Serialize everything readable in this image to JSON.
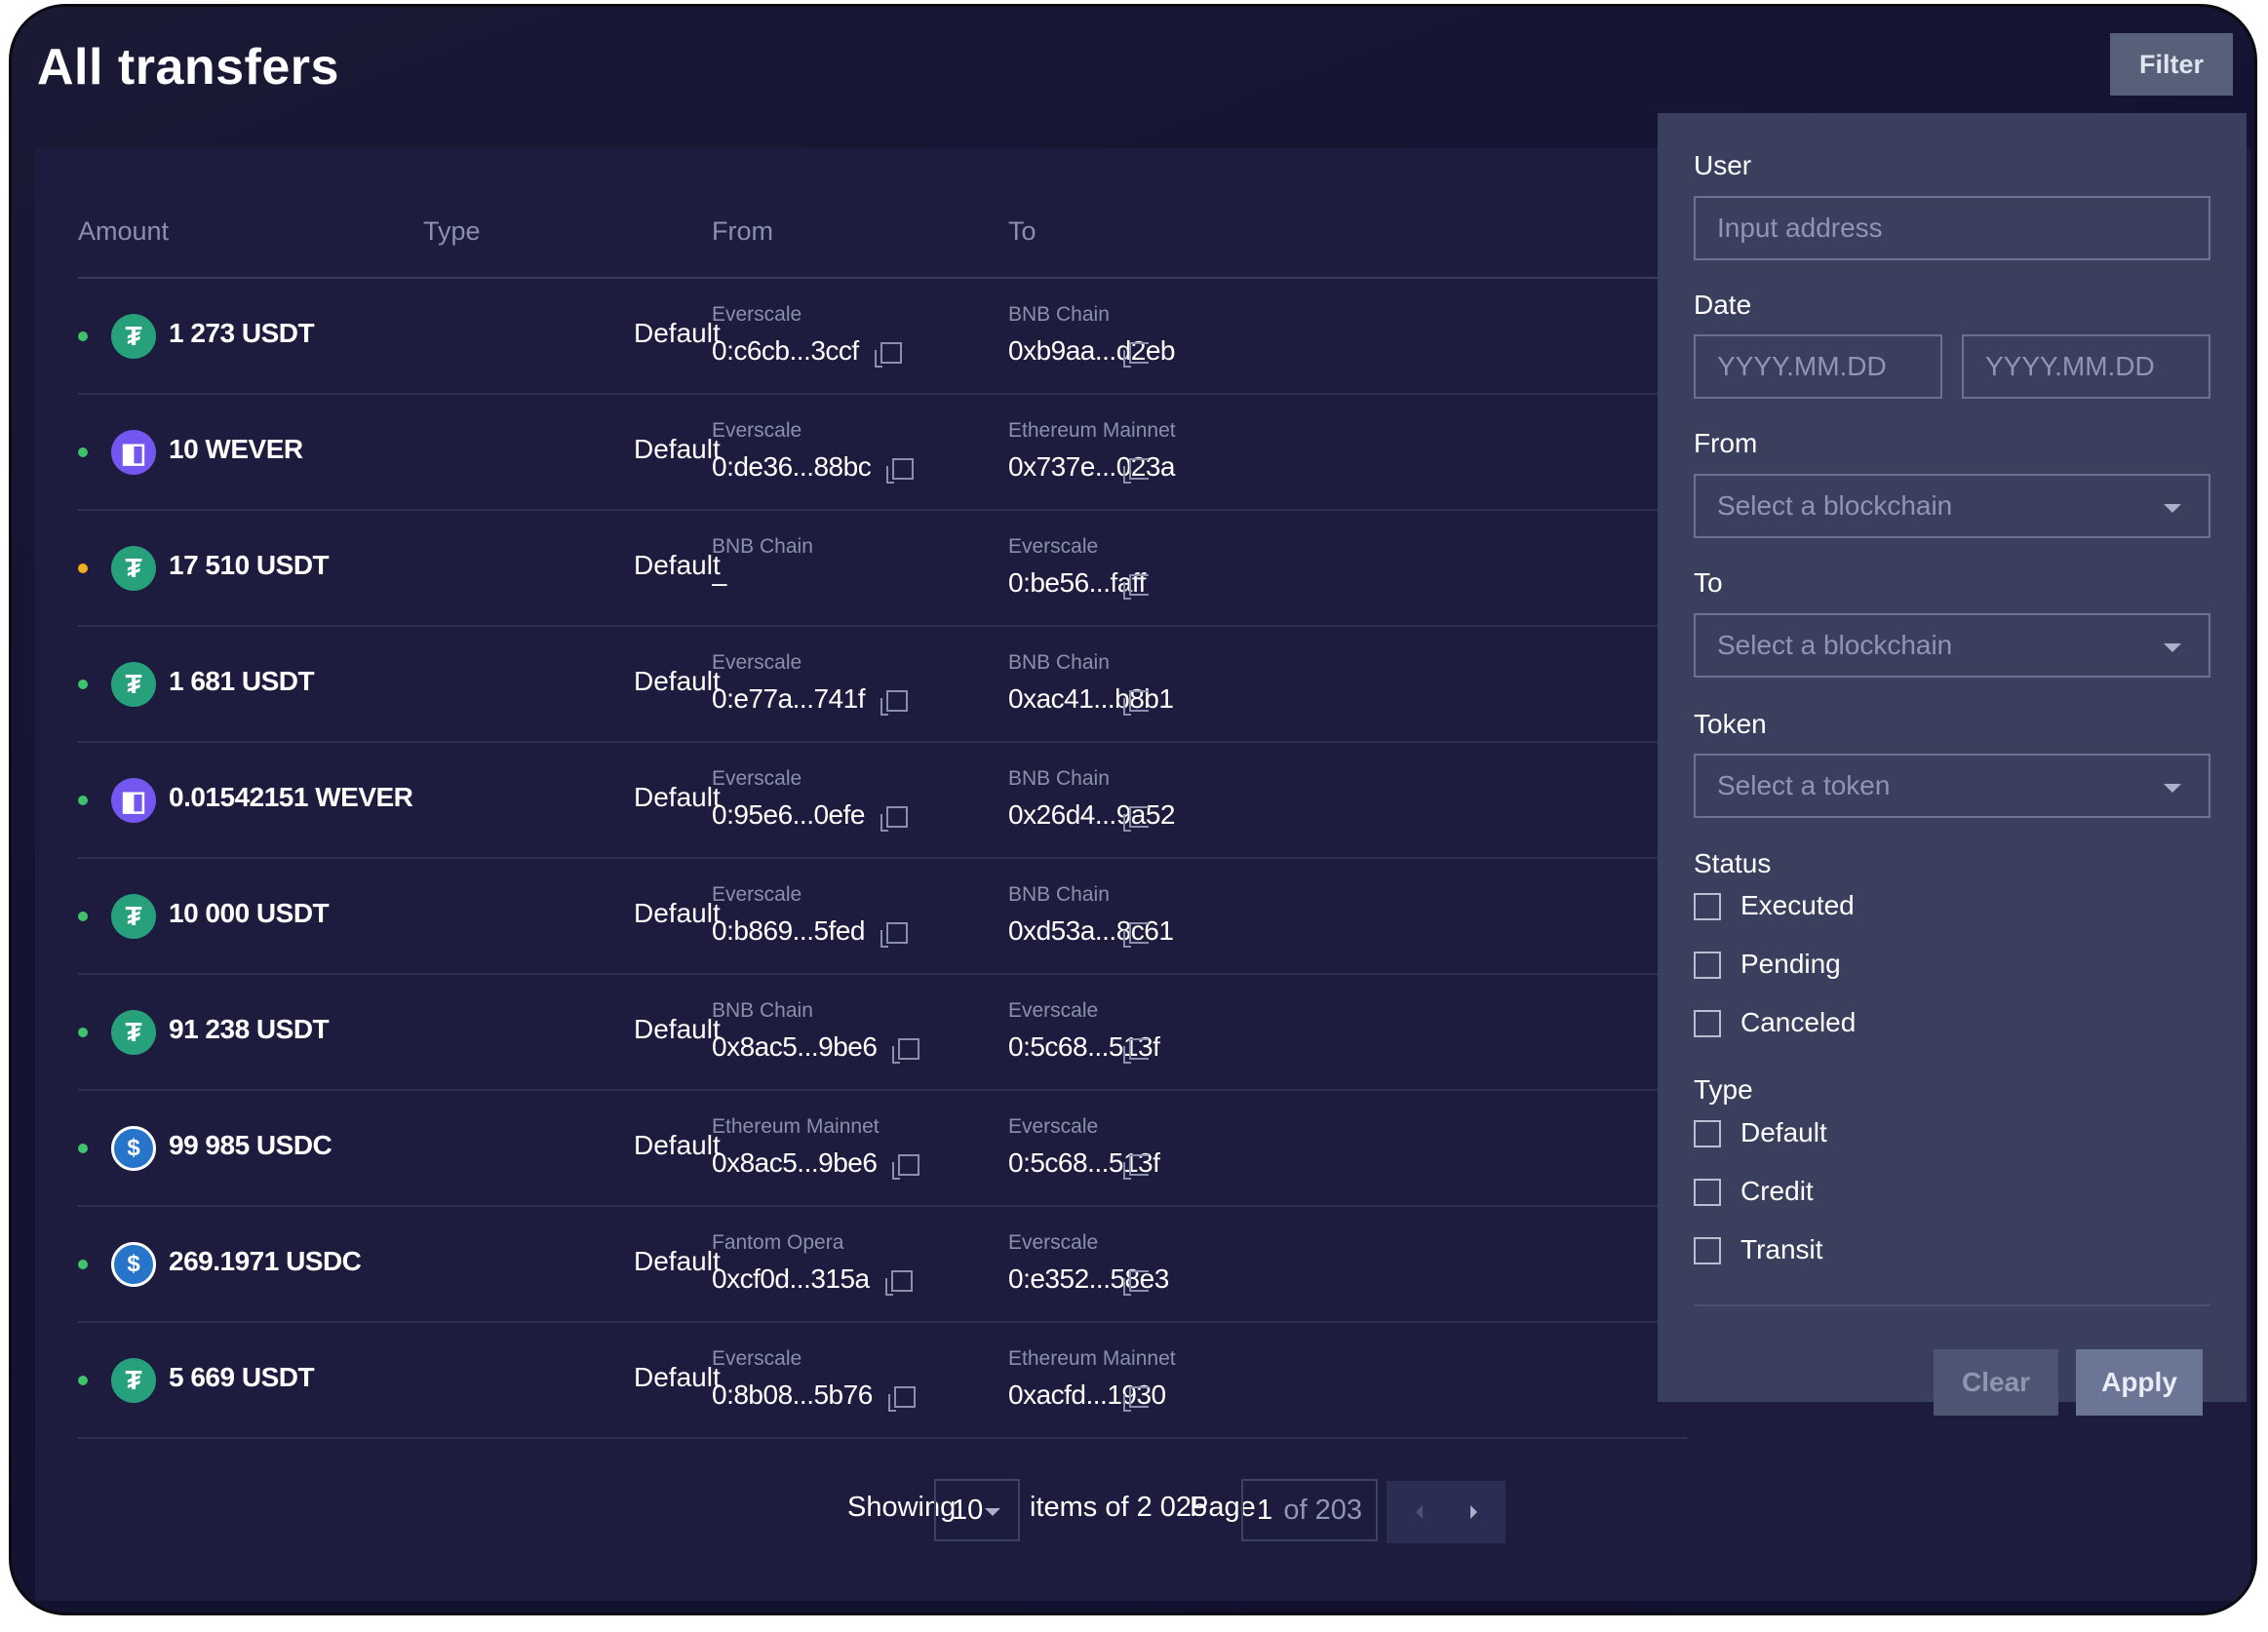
{
  "header": {
    "title": "All transfers",
    "filter_label": "Filter"
  },
  "table": {
    "columns": [
      "Amount",
      "Type",
      "From",
      "To"
    ],
    "rows": [
      {
        "status": "green",
        "token": "usdt",
        "amount": "1 273 USDT",
        "type": "Default",
        "from_chain": "Everscale",
        "from_addr": "0:c6cb...3ccf",
        "to_chain": "BNB Chain",
        "to_addr": "0xb9aa...d2eb"
      },
      {
        "status": "green",
        "token": "wever",
        "amount": "10 WEVER",
        "type": "Default",
        "from_chain": "Everscale",
        "from_addr": "0:de36...88bc",
        "to_chain": "Ethereum Mainnet",
        "to_addr": "0x737e...023a"
      },
      {
        "status": "yellow",
        "token": "usdt",
        "amount": "17 510 USDT",
        "type": "Default",
        "from_chain": "BNB Chain",
        "from_addr": "–",
        "to_chain": "Everscale",
        "to_addr": "0:be56...faff"
      },
      {
        "status": "green",
        "token": "usdt",
        "amount": "1 681 USDT",
        "type": "Default",
        "from_chain": "Everscale",
        "from_addr": "0:e77a...741f",
        "to_chain": "BNB Chain",
        "to_addr": "0xac41...b8b1"
      },
      {
        "status": "green",
        "token": "wever",
        "amount": "0.01542151 WEVER",
        "type": "Default",
        "from_chain": "Everscale",
        "from_addr": "0:95e6...0efe",
        "to_chain": "BNB Chain",
        "to_addr": "0x26d4...9a52"
      },
      {
        "status": "green",
        "token": "usdt",
        "amount": "10 000 USDT",
        "type": "Default",
        "from_chain": "Everscale",
        "from_addr": "0:b869...5fed",
        "to_chain": "BNB Chain",
        "to_addr": "0xd53a...8c61"
      },
      {
        "status": "green",
        "token": "usdt",
        "amount": "91 238 USDT",
        "type": "Default",
        "from_chain": "BNB Chain",
        "from_addr": "0x8ac5...9be6",
        "to_chain": "Everscale",
        "to_addr": "0:5c68...513f"
      },
      {
        "status": "green",
        "token": "usdc",
        "amount": "99 985 USDC",
        "type": "Default",
        "from_chain": "Ethereum Mainnet",
        "from_addr": "0x8ac5...9be6",
        "to_chain": "Everscale",
        "to_addr": "0:5c68...513f"
      },
      {
        "status": "green",
        "token": "usdc",
        "amount": "269.1971 USDC",
        "type": "Default",
        "from_chain": "Fantom Opera",
        "from_addr": "0xcf0d...315a",
        "to_chain": "Everscale",
        "to_addr": "0:e352...58e3"
      },
      {
        "status": "green",
        "token": "usdt",
        "amount": "5 669 USDT",
        "type": "Default",
        "from_chain": "Everscale",
        "from_addr": "0:8b08...5b76",
        "to_chain": "Ethereum Mainnet",
        "to_addr": "0xacfd...1930"
      }
    ]
  },
  "pagination": {
    "showing_label": "Showing",
    "page_size": "10",
    "items_text": "items of 2 025",
    "page_label": "Page",
    "page_value": "1",
    "page_total": "of 203"
  },
  "filter_panel": {
    "user_label": "User",
    "user_placeholder": "Input address",
    "date_label": "Date",
    "date_from_placeholder": "YYYY.MM.DD",
    "date_to_placeholder": "YYYY.MM.DD",
    "from_label": "From",
    "from_placeholder": "Select a blockchain",
    "to_label": "To",
    "to_placeholder": "Select a blockchain",
    "token_label": "Token",
    "token_placeholder": "Select a token",
    "status_label": "Status",
    "status_options": [
      "Executed",
      "Pending",
      "Canceled"
    ],
    "type_label": "Type",
    "type_options": [
      "Default",
      "Credit",
      "Transit"
    ],
    "clear_label": "Clear",
    "apply_label": "Apply"
  },
  "colors": {
    "status_green": "#3ec26b",
    "status_yellow": "#f2b01e",
    "accent": "#566079"
  },
  "icons": {
    "usdt": "tether-icon",
    "wever": "wever-icon",
    "usdc": "usdc-icon",
    "copy": "copy-icon"
  }
}
